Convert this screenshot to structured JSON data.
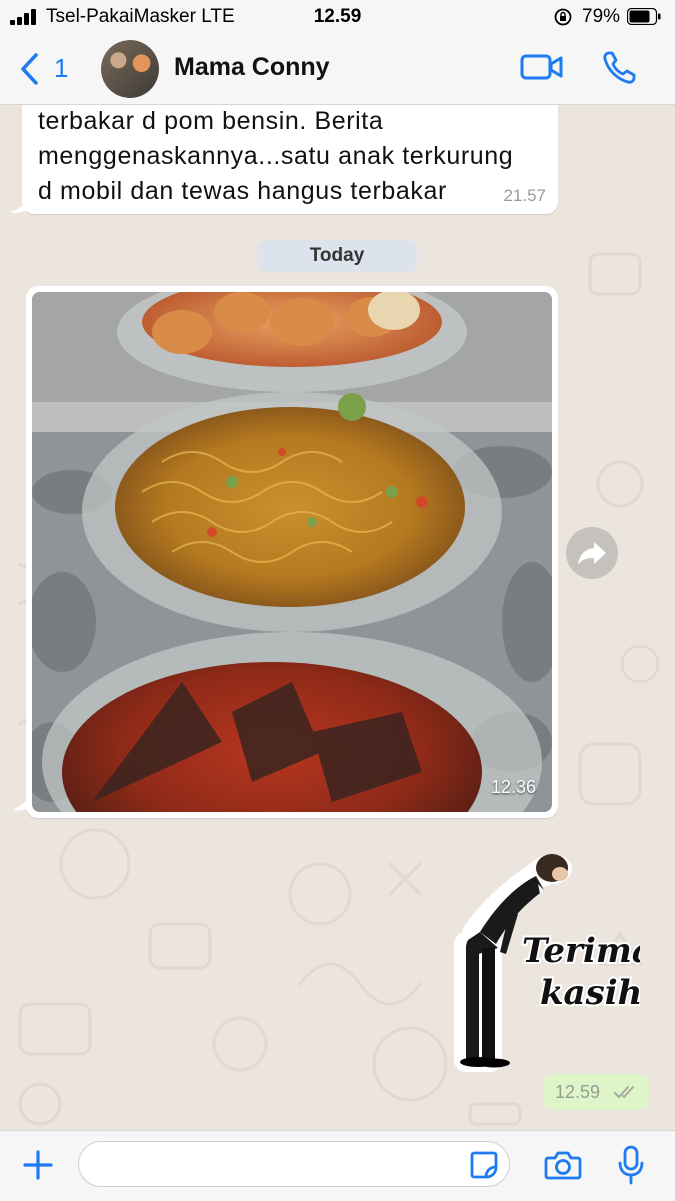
{
  "status_bar": {
    "carrier": "Tsel-PakaiMasker  LTE",
    "time": "12.59",
    "battery_percent": "79%",
    "battery_level": 0.79
  },
  "header": {
    "back_count": "1",
    "contact_name": "Mama Conny",
    "accent_color": "#1E7BF2"
  },
  "messages": {
    "incoming_text": {
      "lines": [
        "terbakar d pom bensin. Berita",
        "menggenaskannya...satu anak terkurung",
        "d mobil dan tewas hangus terbakar"
      ],
      "time": "21.57"
    },
    "date_separator": "Today",
    "incoming_photo": {
      "time": "12.36"
    },
    "outgoing_sticker": {
      "caption_line1": "Terima",
      "caption_line2": "kasih",
      "time": "12.59"
    }
  },
  "composer": {
    "placeholder": ""
  },
  "icons": {
    "back": "chevron-left-icon",
    "video": "video-camera-icon",
    "phone": "phone-icon",
    "forward": "forward-icon",
    "plus": "plus-icon",
    "sticker": "sticker-icon",
    "camera": "camera-icon",
    "mic": "microphone-icon",
    "read_receipt": "double-check-icon"
  }
}
